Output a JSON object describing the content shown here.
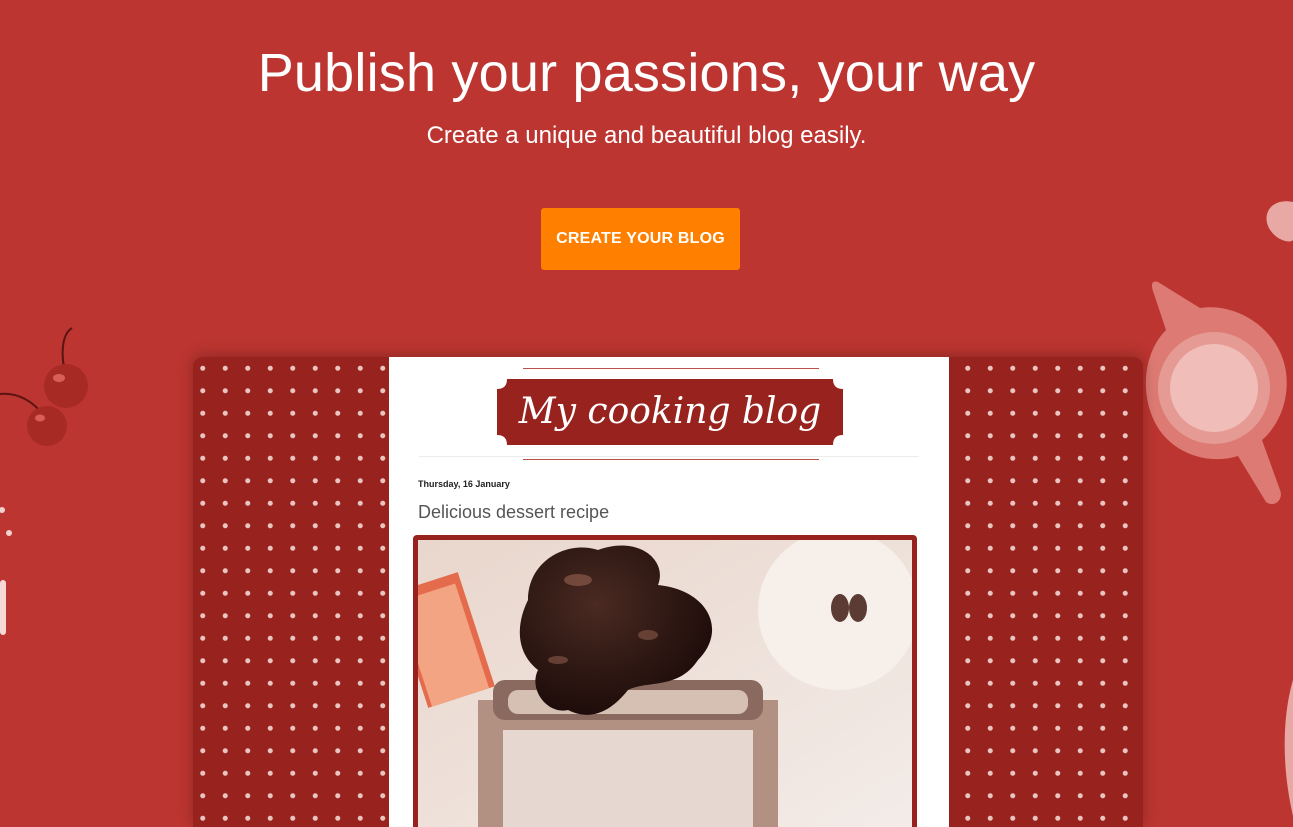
{
  "hero": {
    "title": "Publish your passions, your way",
    "subtitle": "Create a unique and beautiful blog easily.",
    "cta_label": "CREATE YOUR BLOG"
  },
  "preview": {
    "blog_title": "My cooking blog",
    "post_date": "Thursday, 16 January",
    "post_title": "Delicious dessert recipe"
  },
  "colors": {
    "background": "#bc3530",
    "cta": "#ff8000",
    "frame": "#97221e",
    "dots": "#e9c4c0"
  },
  "icons": [
    "cherries-icon",
    "milk-jug-icon",
    "dessert-jar-photo"
  ]
}
